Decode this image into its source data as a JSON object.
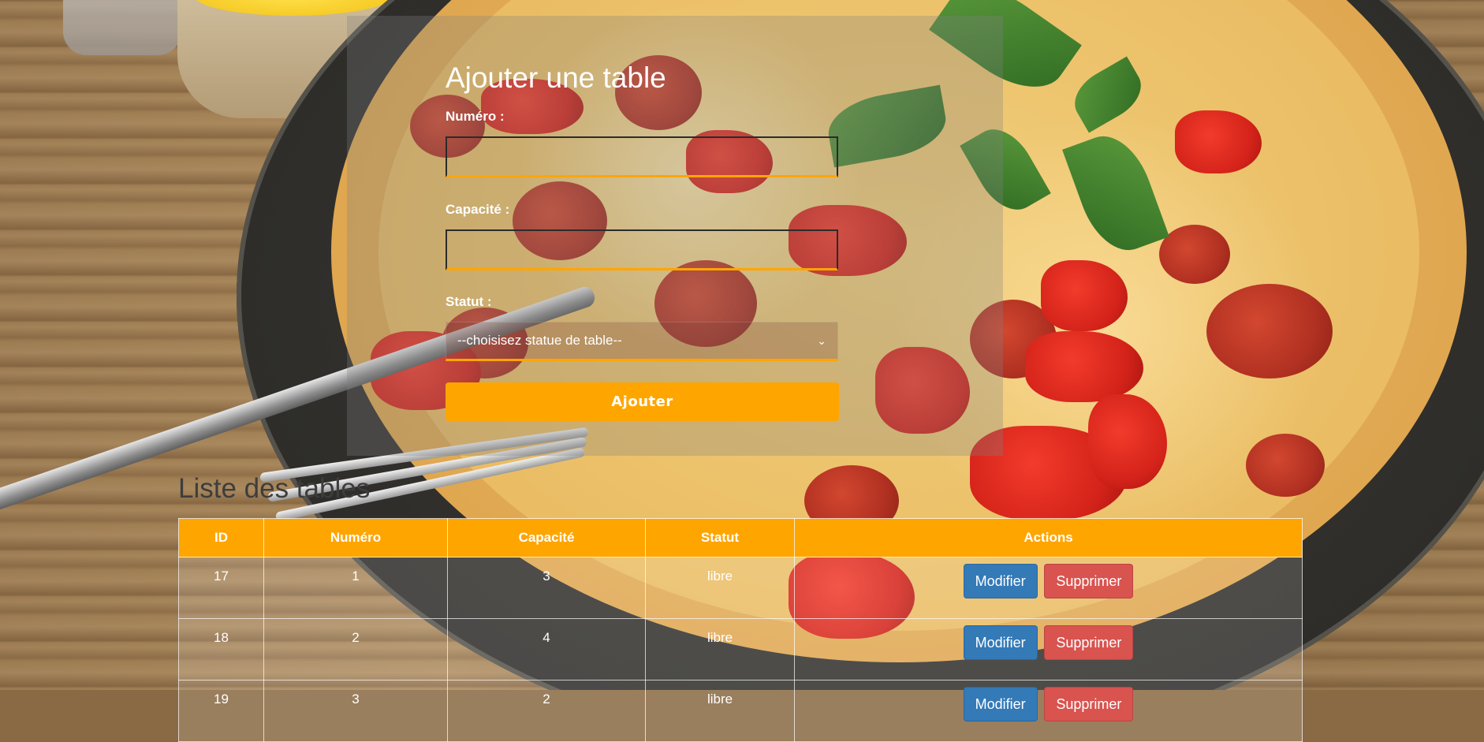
{
  "form": {
    "title": "Ajouter une table",
    "numero_label": "Numéro :",
    "numero_value": "",
    "capacite_label": "Capacité :",
    "capacite_value": "",
    "statut_label": "Statut :",
    "statut_selected": "--choisisez statue de table--",
    "submit_label": "Ajouter"
  },
  "list": {
    "title": "Liste des tables",
    "columns": [
      "ID",
      "Numéro",
      "Capacité",
      "Statut",
      "Actions"
    ],
    "rows": [
      {
        "id": "17",
        "numero": "1",
        "capacite": "3",
        "statut": "libre"
      },
      {
        "id": "18",
        "numero": "2",
        "capacite": "4",
        "statut": "libre"
      },
      {
        "id": "19",
        "numero": "3",
        "capacite": "2",
        "statut": "libre"
      }
    ],
    "modify_label": "Modifier",
    "delete_label": "Supprimer"
  },
  "colors": {
    "accent": "#ffa500",
    "modify_button": "#337ab7",
    "delete_button": "#d9534f"
  },
  "icons": {
    "select_arrow": "chevron-down-icon"
  }
}
